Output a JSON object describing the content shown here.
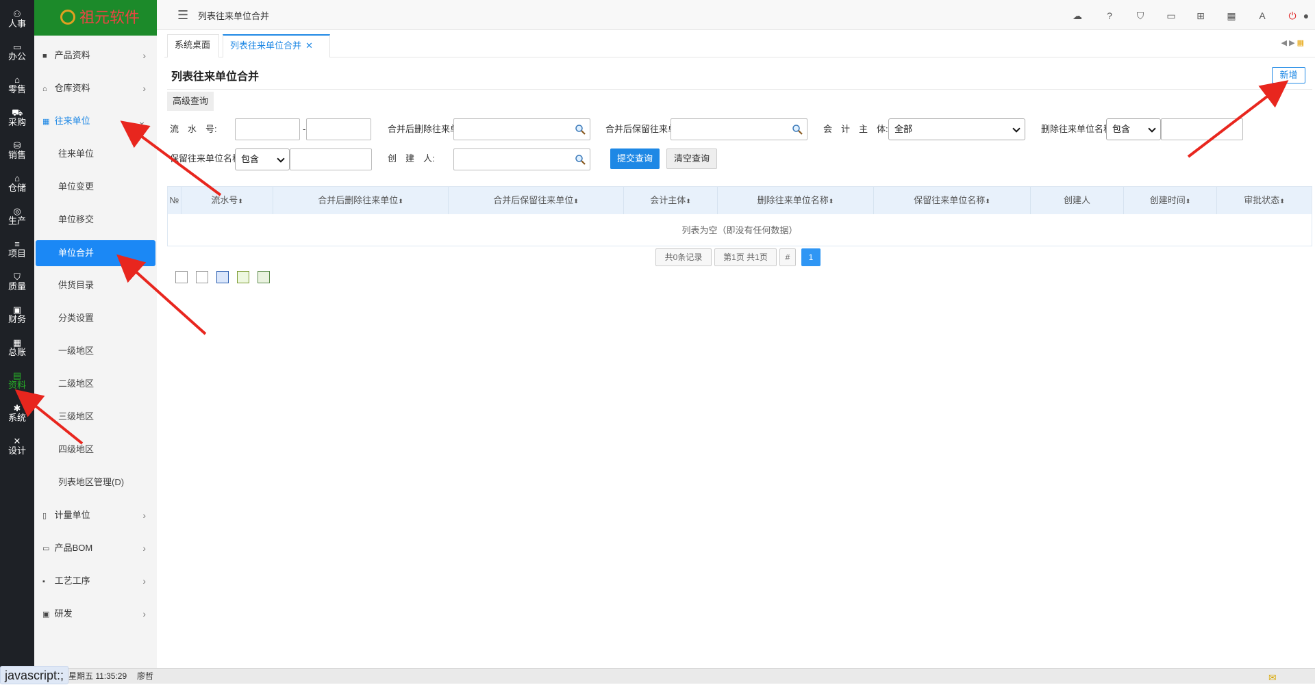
{
  "rail": [
    {
      "icon": "people-icon",
      "glyph": "⚇",
      "label": "人事"
    },
    {
      "icon": "monitor-icon",
      "glyph": "▭",
      "label": "办公"
    },
    {
      "icon": "store-icon",
      "glyph": "⌂",
      "label": "零售"
    },
    {
      "icon": "truck-icon",
      "glyph": "⛟",
      "label": "采购"
    },
    {
      "icon": "cart-icon",
      "glyph": "⛁",
      "label": "销售"
    },
    {
      "icon": "warehouse-icon",
      "glyph": "⌂",
      "label": "仓储"
    },
    {
      "icon": "fingerprint-icon",
      "glyph": "◎",
      "label": "生产"
    },
    {
      "icon": "layers-icon",
      "glyph": "≡",
      "label": "项目"
    },
    {
      "icon": "shield-icon",
      "glyph": "⛉",
      "label": "质量"
    },
    {
      "icon": "finance-icon",
      "glyph": "▣",
      "label": "财务"
    },
    {
      "icon": "ledger-icon",
      "glyph": "▦",
      "label": "总账"
    },
    {
      "icon": "document-icon",
      "glyph": "▤",
      "label": "资料"
    },
    {
      "icon": "gear-icon",
      "glyph": "✱",
      "label": "系统"
    },
    {
      "icon": "tools-icon",
      "glyph": "✕",
      "label": "设计"
    }
  ],
  "logo": {
    "text": "祖元软件"
  },
  "menu": {
    "groups": [
      {
        "icon": "folder-icon",
        "glyph": "■",
        "label": "产品资料"
      },
      {
        "icon": "home-icon",
        "glyph": "⌂",
        "label": "仓库资料"
      },
      {
        "icon": "building-icon",
        "glyph": "▦",
        "label": "往来单位"
      }
    ],
    "subitems": [
      "往来单位",
      "单位变更",
      "单位移交",
      "单位合并",
      "供货目录",
      "分类设置",
      "一级地区",
      "二级地区",
      "三级地区",
      "四级地区",
      "列表地区管理(D)"
    ],
    "groups_after": [
      {
        "icon": "scale-icon",
        "glyph": "▯",
        "label": "计量单位"
      },
      {
        "icon": "bom-icon",
        "glyph": "▭",
        "label": "产品BOM"
      },
      {
        "icon": "process-icon",
        "glyph": "▪",
        "label": "工艺工序"
      },
      {
        "icon": "research-icon",
        "glyph": "▣",
        "label": "研发"
      }
    ]
  },
  "topbar": {
    "title": "列表往来单位合并"
  },
  "tabs": [
    {
      "label": "系统桌面"
    },
    {
      "label": "列表往来单位合并",
      "close": "✕"
    }
  ],
  "page": {
    "title": "列表往来单位合并",
    "new_button": "新增",
    "adv_tab": "高级查询"
  },
  "filters": {
    "serial_label": "流　水　号:",
    "serial_sep": "-",
    "after_delete_label": "合并后删除往来单",
    "after_keep_label": "合并后保留往来单",
    "entity_label": "会　计　主　体:",
    "entity_value": "全部",
    "delete_name_label": "删除往来单位名称",
    "delete_name_mode": "包含",
    "keep_name_label": "保留往来单位名称",
    "keep_name_mode": "包含",
    "creator_label": "创　建　人:",
    "submit": "提交查询",
    "clear": "清空查询"
  },
  "grid": {
    "columns": [
      "№",
      "流水号",
      "合并后删除往来单位",
      "合并后保留往来单位",
      "会计主体",
      "删除往来单位名称",
      "保留往来单位名称",
      "创建人",
      "创建时间",
      "审批状态"
    ],
    "sort_mark": "⬍",
    "empty": "列表为空（即没有任何数据）"
  },
  "pager": {
    "records": "共0条记录",
    "pages": "第1页 共1页",
    "hash": "#",
    "current": "1"
  },
  "status": {
    "link": "javascript:;",
    "datetime": "星期五 11:35:29",
    "user": "廖哲"
  },
  "colors": {
    "accent": "#1e88e5",
    "rail": "#1e2126",
    "logo_bg": "#1c8a2a",
    "arrow": "#e8261e"
  }
}
